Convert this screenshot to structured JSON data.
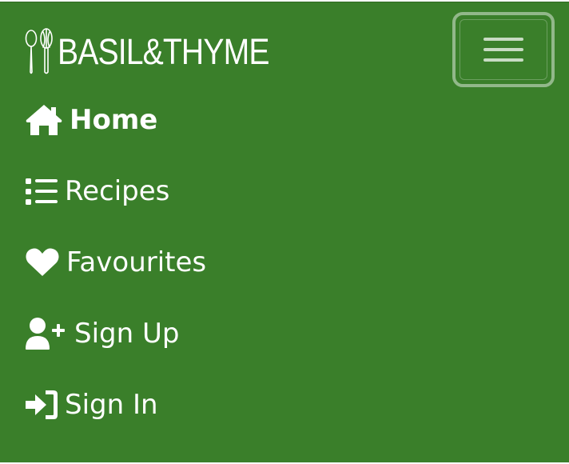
{
  "brand": {
    "name": "BASIL&THYME",
    "logo_icon": "utensils-icon"
  },
  "toggler": {
    "icon": "hamburger-menu-icon"
  },
  "nav": {
    "items": [
      {
        "label": "Home",
        "icon": "home-icon",
        "active": true
      },
      {
        "label": "Recipes",
        "icon": "list-icon",
        "active": false
      },
      {
        "label": "Favourites",
        "icon": "heart-icon",
        "active": false
      },
      {
        "label": "Sign Up",
        "icon": "user-plus-icon",
        "active": false
      },
      {
        "label": "Sign In",
        "icon": "sign-in-icon",
        "active": false
      }
    ]
  },
  "colors": {
    "navbar_background": "#3a7f2a",
    "text": "#ffffff"
  }
}
